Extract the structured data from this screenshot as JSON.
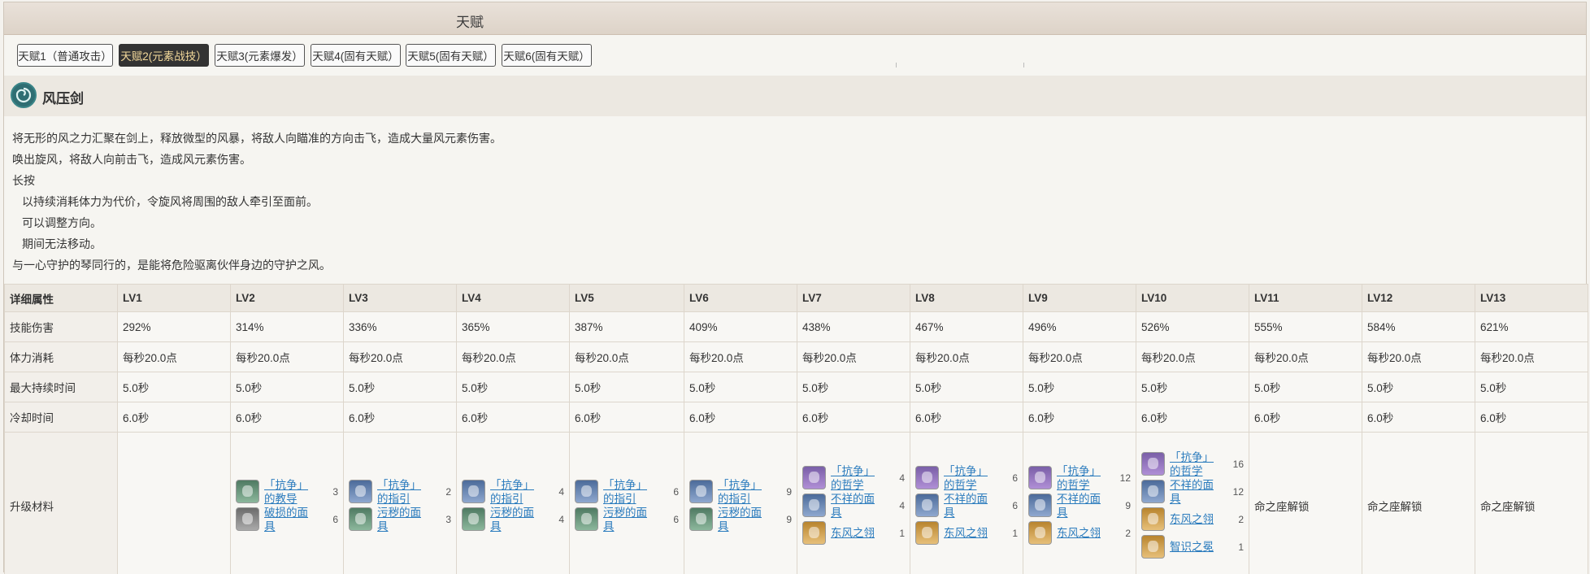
{
  "header": {
    "title": "天赋"
  },
  "tabs": [
    {
      "label": "天赋1（普通攻击）",
      "active": false
    },
    {
      "label": "天赋2(元素战技）",
      "active": true
    },
    {
      "label": "天赋3(元素爆发）",
      "active": false
    },
    {
      "label": "天赋4(固有天赋）",
      "active": false
    },
    {
      "label": "天赋5(固有天赋）",
      "active": false
    },
    {
      "label": "天赋6(固有天赋）",
      "active": false
    }
  ],
  "skill": {
    "name": "风压剑",
    "icon": "anemo-swirl-icon",
    "description": [
      "将无形的风之力汇聚在剑上，释放微型的风暴，将敌人向瞄准的方向击飞，造成大量风元素伤害。",
      "唤出旋风，将敌人向前击飞，造成风元素伤害。",
      "长按",
      "以持续消耗体力为代价，令旋风将周围的敌人牵引至面前。",
      "可以调整方向。",
      "期间无法移动。",
      "与一心守护的琴同行的，是能将危险驱离伙伴身边的守护之风。"
    ]
  },
  "table": {
    "header": [
      "详细属性",
      "LV1",
      "LV2",
      "LV3",
      "LV4",
      "LV5",
      "LV6",
      "LV7",
      "LV8",
      "LV9",
      "LV10",
      "LV11",
      "LV12",
      "LV13"
    ],
    "rows": [
      {
        "label": "技能伤害",
        "values": [
          "292%",
          "314%",
          "336%",
          "365%",
          "387%",
          "409%",
          "438%",
          "467%",
          "496%",
          "526%",
          "555%",
          "584%",
          "621%"
        ]
      },
      {
        "label": "体力消耗",
        "values": [
          "每秒20.0点",
          "每秒20.0点",
          "每秒20.0点",
          "每秒20.0点",
          "每秒20.0点",
          "每秒20.0点",
          "每秒20.0点",
          "每秒20.0点",
          "每秒20.0点",
          "每秒20.0点",
          "每秒20.0点",
          "每秒20.0点",
          "每秒20.0点"
        ]
      },
      {
        "label": "最大持续时间",
        "values": [
          "5.0秒",
          "5.0秒",
          "5.0秒",
          "5.0秒",
          "5.0秒",
          "5.0秒",
          "5.0秒",
          "5.0秒",
          "5.0秒",
          "5.0秒",
          "5.0秒",
          "5.0秒",
          "5.0秒"
        ]
      },
      {
        "label": "冷却时间",
        "values": [
          "6.0秒",
          "6.0秒",
          "6.0秒",
          "6.0秒",
          "6.0秒",
          "6.0秒",
          "6.0秒",
          "6.0秒",
          "6.0秒",
          "6.0秒",
          "6.0秒",
          "6.0秒",
          "6.0秒"
        ]
      }
    ],
    "materials_label": "升级材料",
    "materials": [
      [],
      [
        {
          "name": "「抗争」的教导",
          "count": "3",
          "color": "green"
        },
        {
          "name": "破损的面具",
          "count": "6",
          "color": "gray"
        }
      ],
      [
        {
          "name": "「抗争」的指引",
          "count": "2",
          "color": "blue"
        },
        {
          "name": "污秽的面具",
          "count": "3",
          "color": "green"
        }
      ],
      [
        {
          "name": "「抗争」的指引",
          "count": "4",
          "color": "blue"
        },
        {
          "name": "污秽的面具",
          "count": "4",
          "color": "green"
        }
      ],
      [
        {
          "name": "「抗争」的指引",
          "count": "6",
          "color": "blue"
        },
        {
          "name": "污秽的面具",
          "count": "6",
          "color": "green"
        }
      ],
      [
        {
          "name": "「抗争」的指引",
          "count": "9",
          "color": "blue"
        },
        {
          "name": "污秽的面具",
          "count": "9",
          "color": "green"
        }
      ],
      [
        {
          "name": "「抗争」的哲学",
          "count": "4",
          "color": "purple"
        },
        {
          "name": "不祥的面具",
          "count": "4",
          "color": "blue"
        },
        {
          "name": "东风之翎",
          "count": "1",
          "color": "gold"
        }
      ],
      [
        {
          "name": "「抗争」的哲学",
          "count": "6",
          "color": "purple"
        },
        {
          "name": "不祥的面具",
          "count": "6",
          "color": "blue"
        },
        {
          "name": "东风之翎",
          "count": "1",
          "color": "gold"
        }
      ],
      [
        {
          "name": "「抗争」的哲学",
          "count": "12",
          "color": "purple"
        },
        {
          "name": "不祥的面具",
          "count": "9",
          "color": "blue"
        },
        {
          "name": "东风之翎",
          "count": "2",
          "color": "gold"
        }
      ],
      [
        {
          "name": "「抗争」的哲学",
          "count": "16",
          "color": "purple"
        },
        {
          "name": "不祥的面具",
          "count": "12",
          "color": "blue"
        },
        {
          "name": "东风之翎",
          "count": "2",
          "color": "gold"
        },
        {
          "name": "智识之冕",
          "count": "1",
          "color": "gold"
        }
      ],
      "命之座解锁",
      "命之座解锁",
      "命之座解锁"
    ]
  }
}
